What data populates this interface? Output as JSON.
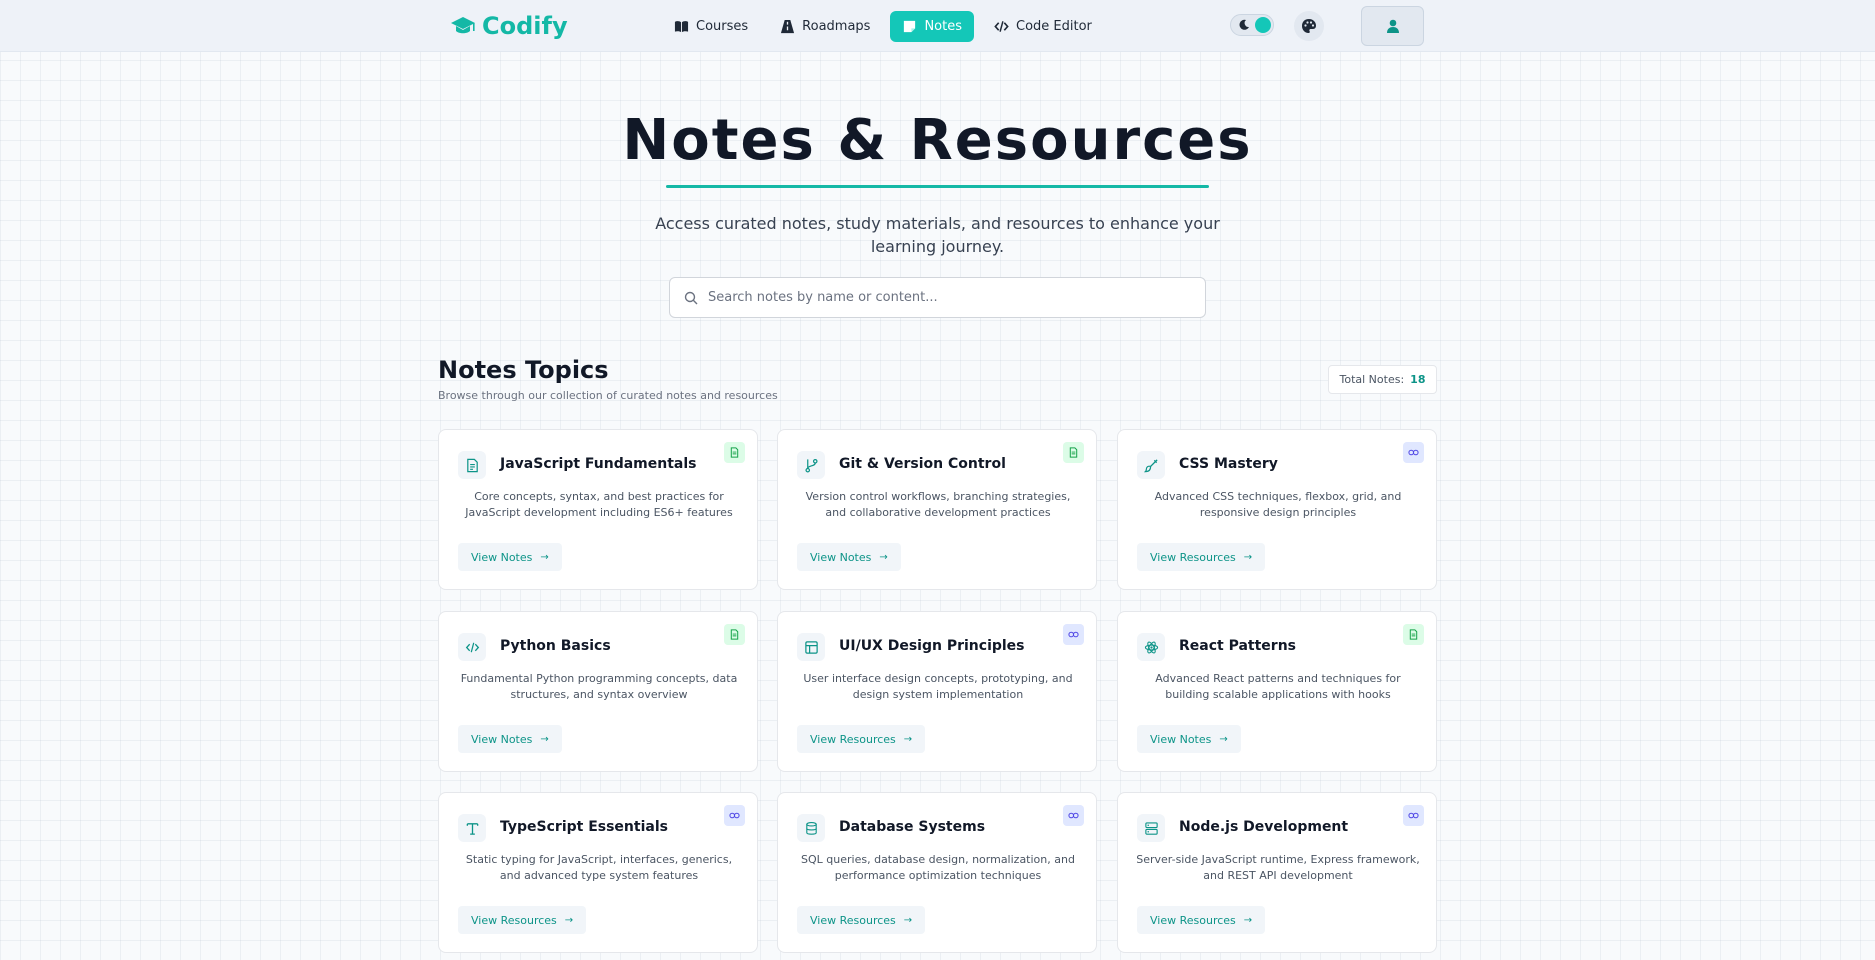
{
  "brand": {
    "name": "Codify"
  },
  "nav": {
    "links": [
      {
        "label": "Courses",
        "icon": "book-open-icon",
        "active": false
      },
      {
        "label": "Roadmaps",
        "icon": "road-icon",
        "active": false
      },
      {
        "label": "Notes",
        "icon": "sticky-note-icon",
        "active": true
      },
      {
        "label": "Code Editor",
        "icon": "code-icon",
        "active": false
      }
    ],
    "theme_toggle": {
      "icon": "moon-icon",
      "state": "on"
    },
    "palette_icon": "palette-icon",
    "user_icon": "user-icon"
  },
  "hero": {
    "title": "Notes & Resources",
    "subtitle": "Access curated notes, study materials, and resources to enhance your learning journey.",
    "search_placeholder": "Search notes by name or content...",
    "search_value": ""
  },
  "section": {
    "title": "Notes Topics",
    "subtitle": "Browse through our collection of curated notes and resources",
    "total_label": "Total Notes:",
    "total_count": "18"
  },
  "colors": {
    "accent": "#14c7b8",
    "accent_dark": "#0d9488",
    "note_badge": "#dcfce7",
    "link_badge": "#e0e7ff"
  },
  "cards": [
    {
      "title": "JavaScript Fundamentals",
      "description": "Core concepts, syntax, and best practices for JavaScript development including ES6+ features",
      "button": "View Notes",
      "type": "note",
      "icon": "file-text-icon"
    },
    {
      "title": "Git & Version Control",
      "description": "Version control workflows, branching strategies, and collaborative development practices",
      "button": "View Notes",
      "type": "note",
      "icon": "git-branch-icon"
    },
    {
      "title": "CSS Mastery",
      "description": "Advanced CSS techniques, flexbox, grid, and responsive design principles",
      "button": "View Resources",
      "type": "link",
      "icon": "brush-icon"
    },
    {
      "title": "Python Basics",
      "description": "Fundamental Python programming concepts, data structures, and syntax overview",
      "button": "View Notes",
      "type": "note",
      "icon": "code-icon"
    },
    {
      "title": "UI/UX Design Principles",
      "description": "User interface design concepts, prototyping, and design system implementation",
      "button": "View Resources",
      "type": "link",
      "icon": "layout-icon"
    },
    {
      "title": "React Patterns",
      "description": "Advanced React patterns and techniques for building scalable applications with hooks",
      "button": "View Notes",
      "type": "note",
      "icon": "atom-icon"
    },
    {
      "title": "TypeScript Essentials",
      "description": "Static typing for JavaScript, interfaces, generics, and advanced type system features",
      "button": "View Resources",
      "type": "link",
      "icon": "type-icon"
    },
    {
      "title": "Database Systems",
      "description": "SQL queries, database design, normalization, and performance optimization techniques",
      "button": "View Resources",
      "type": "link",
      "icon": "database-icon"
    },
    {
      "title": "Node.js Development",
      "description": "Server-side JavaScript runtime, Express framework, and REST API development",
      "button": "View Resources",
      "type": "link",
      "icon": "server-icon"
    }
  ]
}
